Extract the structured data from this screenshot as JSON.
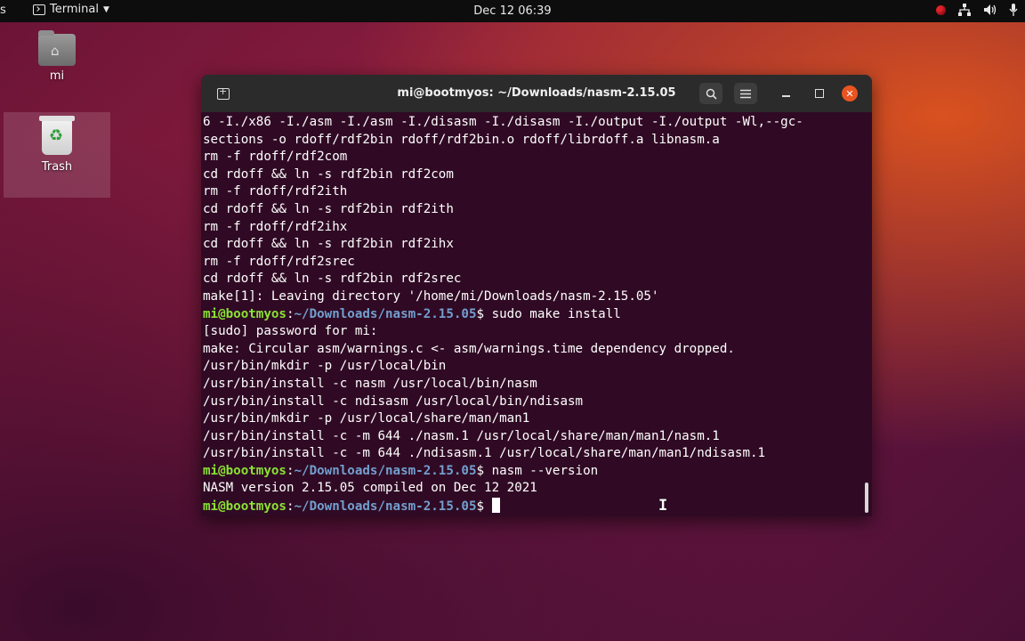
{
  "topbar": {
    "left_edge_text": "s",
    "app_menu": {
      "icon": "terminal-icon",
      "label": "Terminal"
    },
    "clock": "Dec 12  06:39",
    "tray": [
      "record-indicator",
      "network-icon",
      "volume-icon",
      "microphone-icon"
    ]
  },
  "desktop": {
    "icons": [
      {
        "label": "mi",
        "icon": "home-folder-icon"
      },
      {
        "label": "Trash",
        "icon": "trash-icon"
      }
    ]
  },
  "window": {
    "title": "mi@bootmyos: ~/Downloads/nasm-2.15.05",
    "buttons": [
      "new-tab",
      "search",
      "menu",
      "minimize",
      "maximize",
      "close"
    ],
    "prompt_user": "mi@bootmyos",
    "prompt_path": "~/Downloads/nasm-2.15.05",
    "lines": [
      "6 -I./x86 -I./asm -I./asm -I./disasm -I./disasm -I./output -I./output -Wl,--gc-",
      "sections -o rdoff/rdf2bin rdoff/rdf2bin.o rdoff/librdoff.a libnasm.a",
      "rm -f rdoff/rdf2com",
      "cd rdoff && ln -s rdf2bin rdf2com",
      "rm -f rdoff/rdf2ith",
      "cd rdoff && ln -s rdf2bin rdf2ith",
      "rm -f rdoff/rdf2ihx",
      "cd rdoff && ln -s rdf2bin rdf2ihx",
      "rm -f rdoff/rdf2srec",
      "cd rdoff && ln -s rdf2bin rdf2srec",
      "make[1]: Leaving directory '/home/mi/Downloads/nasm-2.15.05'",
      "$ sudo make install",
      "[sudo] password for mi:",
      "make: Circular asm/warnings.c <- asm/warnings.time dependency dropped.",
      "/usr/bin/mkdir -p /usr/local/bin",
      "/usr/bin/install -c nasm /usr/local/bin/nasm",
      "/usr/bin/install -c ndisasm /usr/local/bin/ndisasm",
      "/usr/bin/mkdir -p /usr/local/share/man/man1",
      "/usr/bin/install -c -m 644 ./nasm.1 /usr/local/share/man/man1/nasm.1",
      "/usr/bin/install -c -m 644 ./ndisasm.1 /usr/local/share/man/man1/ndisasm.1",
      "$ nasm --version",
      "NASM version 2.15.05 compiled on Dec 12 2021",
      "$"
    ],
    "prompt_line_indices": [
      11,
      20,
      22
    ]
  },
  "colors": {
    "terminal_bg": "#300a24",
    "prompt_user": "#8ae234",
    "prompt_path": "#729fcf",
    "close_button": "#e95420"
  }
}
